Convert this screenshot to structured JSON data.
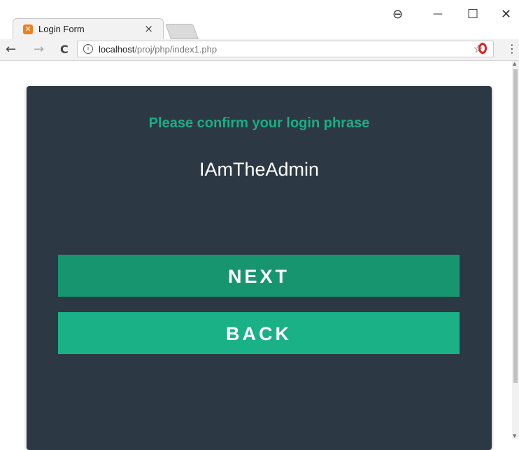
{
  "browser": {
    "tab_title": "Login Form",
    "tab_close": "×",
    "favicon": "xampp-icon",
    "url_host": "localhost",
    "url_path": "/proj/php/index1.php",
    "window_controls": {
      "account": "⊖",
      "minimize": "—",
      "maximize": "☐",
      "close": "✕"
    },
    "nav": {
      "back": "←",
      "forward": "→",
      "reload": "C"
    },
    "icons": {
      "info": "i",
      "star": "☆",
      "menu": "⋮"
    }
  },
  "page": {
    "heading": "Please confirm your login phrase",
    "phrase": "IAmTheAdmin",
    "next_label": "NEXT",
    "back_label": "BACK"
  },
  "colors": {
    "card_bg": "#2c3843",
    "accent": "#1aae85",
    "next_button": "#17956e",
    "back_button": "#1ab187"
  }
}
